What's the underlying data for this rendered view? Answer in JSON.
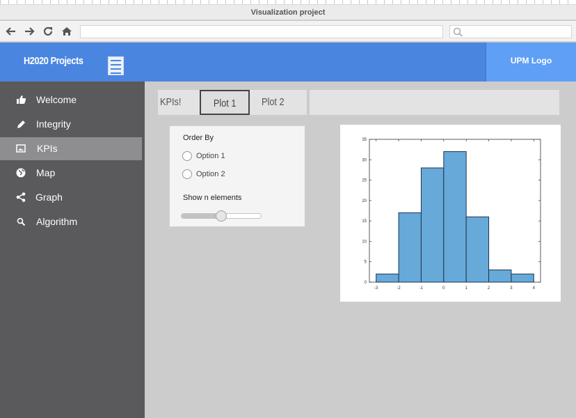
{
  "window": {
    "title": "Visualization project"
  },
  "browser": {
    "url": "",
    "search": ""
  },
  "header": {
    "brand": "H2020 Projects",
    "logo": "UPM Logo"
  },
  "sidebar": {
    "items": [
      {
        "label": "Welcome",
        "icon": "thumbs-up-icon",
        "active": false
      },
      {
        "label": "Integrity",
        "icon": "pencil-icon",
        "active": false
      },
      {
        "label": "KPIs",
        "icon": "image-icon",
        "active": true
      },
      {
        "label": "Map",
        "icon": "globe-icon",
        "active": false
      },
      {
        "label": "Graph",
        "icon": "share-icon",
        "active": false
      },
      {
        "label": "Algorithm",
        "icon": "search-icon",
        "active": false
      }
    ]
  },
  "tabs": {
    "heading": "KPIs!",
    "items": [
      {
        "label": "Plot 1",
        "selected": true
      },
      {
        "label": "Plot 2",
        "selected": false
      }
    ]
  },
  "controls": {
    "order_by": {
      "title": "Order By",
      "options": [
        "Option 1",
        "Option 2"
      ]
    },
    "slider": {
      "title": "Show n elements",
      "value": 0.5
    }
  },
  "chart_data": {
    "type": "bar",
    "bins": [
      [
        -3,
        -2
      ],
      [
        -2,
        -1
      ],
      [
        -1,
        0
      ],
      [
        0,
        1
      ],
      [
        1,
        2
      ],
      [
        2,
        3
      ],
      [
        3,
        4
      ]
    ],
    "values": [
      2,
      17,
      28,
      32,
      16,
      3,
      2
    ],
    "xticks": [
      -3,
      -2,
      -1,
      0,
      1,
      2,
      3,
      4
    ],
    "yticks": [
      0,
      5,
      10,
      15,
      20,
      25,
      30,
      35
    ],
    "xlim": [
      -3.3,
      4.3
    ],
    "ylim": [
      0,
      35
    ],
    "bar_color": "#67a9d8",
    "edge_color": "#1c3550",
    "title": "",
    "xlabel": "",
    "ylabel": ""
  },
  "colors": {
    "header": "#4a86e0",
    "logo_box": "#5f9ff5",
    "sidebar": "#5a595b",
    "sidebar_active": "#8e8d90"
  }
}
